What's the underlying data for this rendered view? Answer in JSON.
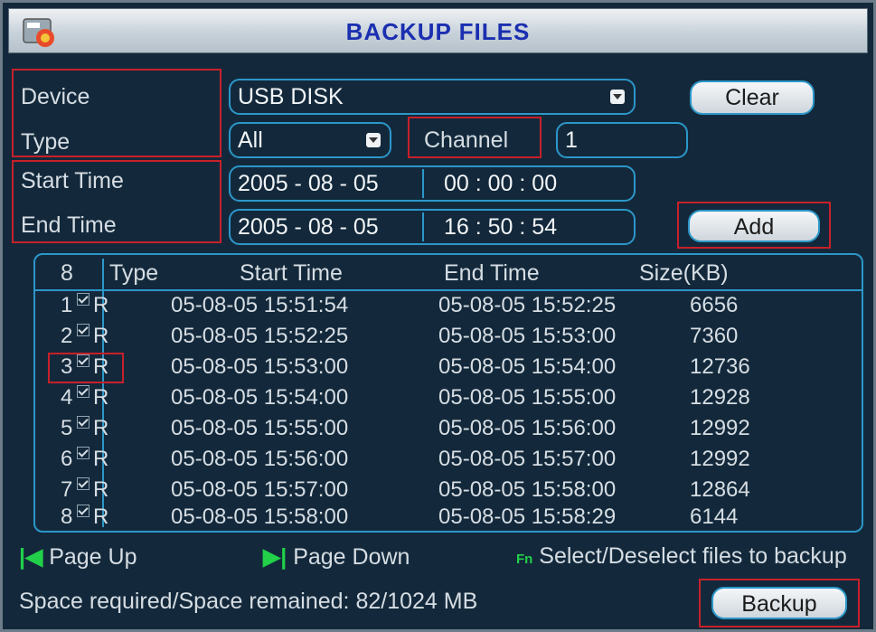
{
  "window": {
    "title": "BACKUP FILES"
  },
  "form": {
    "device_label": "Device",
    "device_value": "USB DISK",
    "type_label": "Type",
    "type_value": "All",
    "channel_label": "Channel",
    "channel_value": "1",
    "start_label": "Start Time",
    "start_date": "2005 - 08 - 05",
    "start_time": "00 : 00 : 00",
    "end_label": "End Time",
    "end_date": "2005 - 08 - 05",
    "end_time": "16 : 50 : 54"
  },
  "buttons": {
    "clear": "Clear",
    "add": "Add",
    "backup": "Backup"
  },
  "table": {
    "headers": {
      "count": "8",
      "type": "Type",
      "start": "Start Time",
      "end": "End Time",
      "size": "Size(KB)"
    },
    "rows": [
      {
        "num": "1",
        "type": "R",
        "start": "05-08-05  15:51:54",
        "end": "05-08-05  15:52:25",
        "size": "6656"
      },
      {
        "num": "2",
        "type": "R",
        "start": "05-08-05  15:52:25",
        "end": "05-08-05  15:53:00",
        "size": "7360"
      },
      {
        "num": "3",
        "type": "R",
        "start": "05-08-05  15:53:00",
        "end": "05-08-05  15:54:00",
        "size": "12736"
      },
      {
        "num": "4",
        "type": "R",
        "start": "05-08-05  15:54:00",
        "end": "05-08-05  15:55:00",
        "size": "12928"
      },
      {
        "num": "5",
        "type": "R",
        "start": "05-08-05  15:55:00",
        "end": "05-08-05  15:56:00",
        "size": "12992"
      },
      {
        "num": "6",
        "type": "R",
        "start": "05-08-05  15:56:00",
        "end": "05-08-05  15:57:00",
        "size": "12992"
      },
      {
        "num": "7",
        "type": "R",
        "start": "05-08-05  15:57:00",
        "end": "05-08-05  15:58:00",
        "size": "12864"
      },
      {
        "num": "8",
        "type": "R",
        "start": "05-08-05  15:58:00",
        "end": "05-08-05  15:58:29",
        "size": "6144"
      }
    ]
  },
  "hints": {
    "page_up": "Page Up",
    "page_down": "Page Down",
    "select_hint": "Select/Deselect files to backup"
  },
  "status": {
    "space": "Space required/Space remained:  82/1024  MB"
  },
  "colors": {
    "highlight": "#c8202a",
    "border": "#2c97c9",
    "title": "#1b2fb0",
    "hint_icon": "#22d04a"
  }
}
